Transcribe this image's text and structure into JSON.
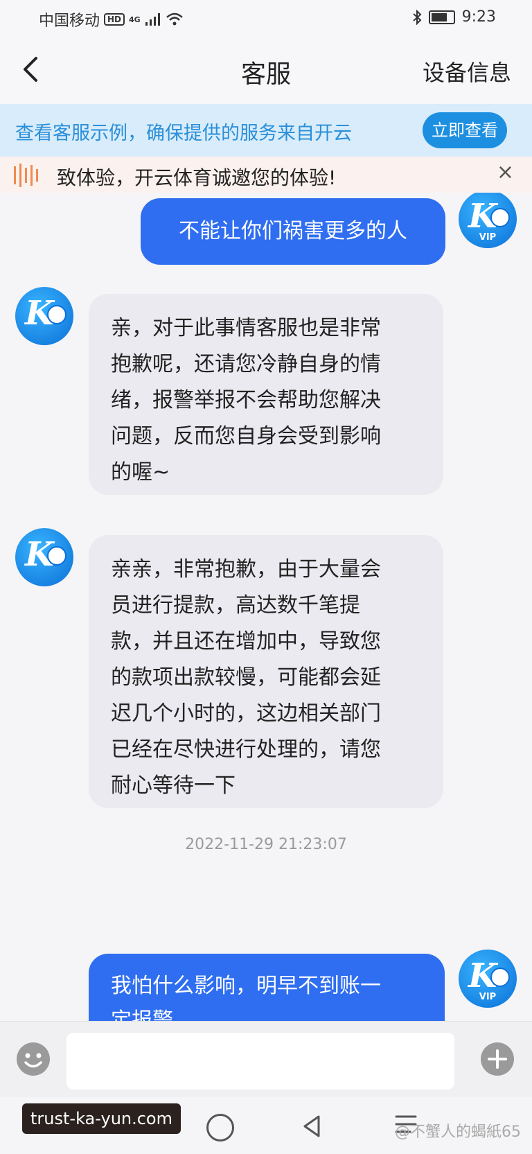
{
  "status_bar": {
    "carrier": "中国移动",
    "hd": "HD",
    "network": "4G",
    "time": "9:23"
  },
  "header": {
    "title": "客服",
    "device_info": "设备信息"
  },
  "banner": {
    "text": "查看客服示例，确保提供的服务来自开云",
    "button": "立即查看"
  },
  "notice": {
    "text": "致体验，开云体育诚邀您的体验!",
    "close": "×"
  },
  "avatar": {
    "logo": "K",
    "vip": "VIP"
  },
  "messages": [
    {
      "side": "out",
      "text": "不能让你们祸害更多的人"
    },
    {
      "side": "in",
      "lines": [
        "亲，对于此事情客服也是非常",
        "抱歉呢，还请您冷静自身的情",
        "绪，报警举报不会帮助您解决",
        "问题，反而您自身会受到影响",
        "的喔~"
      ]
    },
    {
      "side": "in",
      "lines": [
        "亲亲，非常抱歉，由于大量会",
        "员进行提款，高达数千笔提",
        "款，并且还在增加中，导致您",
        "的款项出款较慢，可能都会延",
        "迟几个小时的，这边相关部门",
        "已经在尽快进行处理的，请您",
        "耐心等待一下"
      ]
    },
    {
      "side": "out",
      "lines": [
        "我怕什么影响，明早不到账一",
        "定报警"
      ]
    }
  ],
  "timestamp": "2022-11-29 21:23:07",
  "input": {
    "placeholder": ""
  },
  "watermark": {
    "label": "trust-ka-yun.com",
    "credit": "@不蟹人的蝎紙65"
  },
  "colors": {
    "accent": "#2f6ef0",
    "banner_bg": "#d8ecfb",
    "banner_text": "#2a8fd8",
    "incoming_bubble": "#ebeaf0"
  }
}
